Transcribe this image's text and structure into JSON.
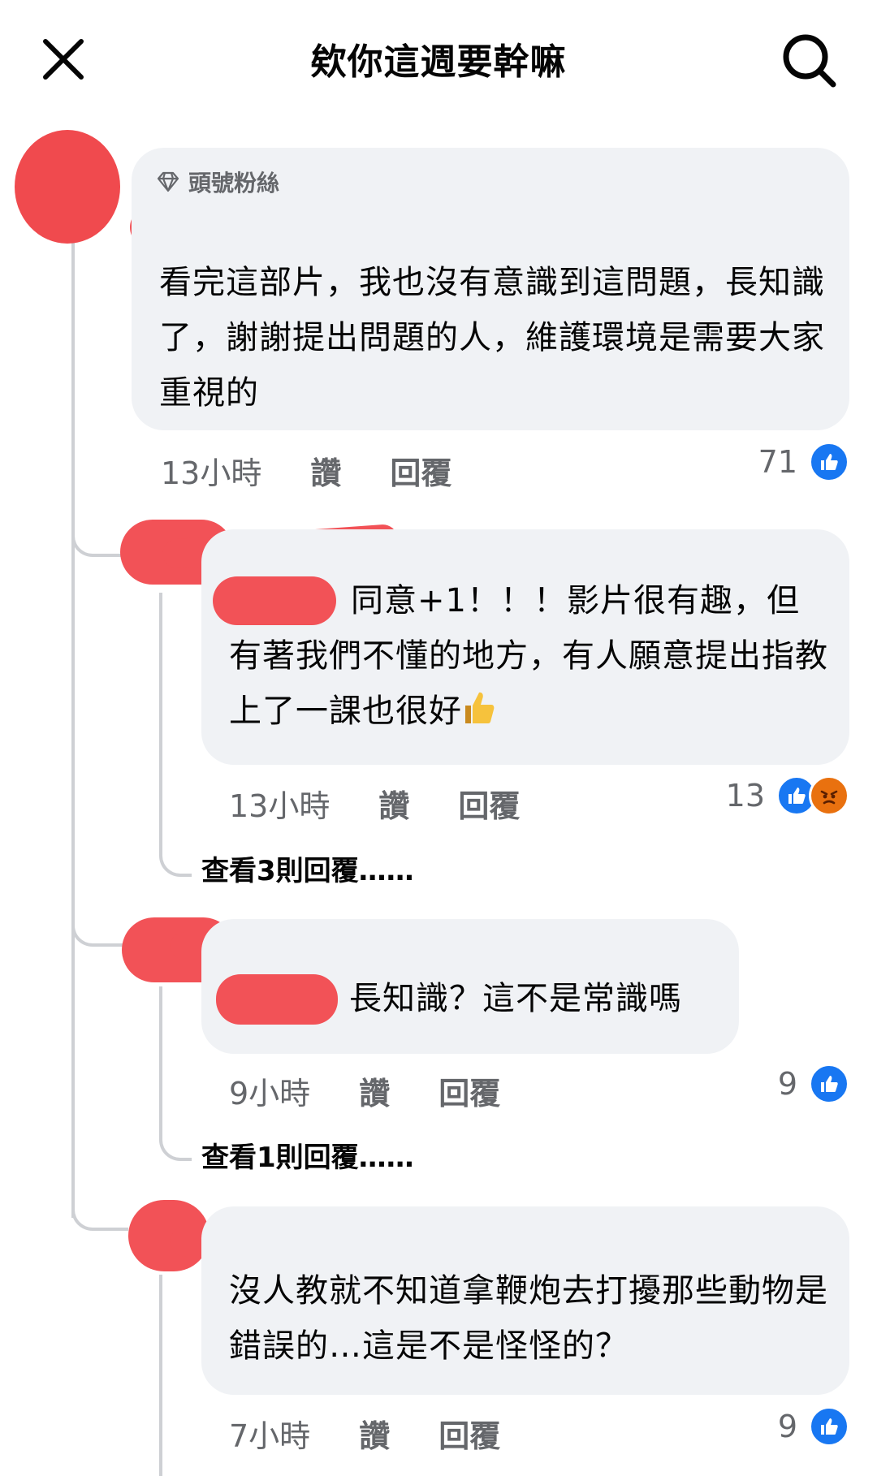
{
  "header": {
    "title": "欸你這週要幹嘛"
  },
  "comments": [
    {
      "badge": "頭號粉絲",
      "text": "看完這部片，我也沒有意識到這問題，長知識了，謝謝提出問題的人，維護環境是需要大家重視的",
      "time": "13小時",
      "like": "讚",
      "reply": "回覆",
      "reactions": "71"
    },
    {
      "text": "同意+1！！！影片很有趣，但有著我們不懂的地方，有人願意提出指教上了一課也很好",
      "time": "13小時",
      "like": "讚",
      "reply": "回覆",
      "reactions": "13",
      "view_replies": "查看3則回覆……"
    },
    {
      "text": "長知識？這不是常識嗎",
      "time": "9小時",
      "like": "讚",
      "reply": "回覆",
      "reactions": "9",
      "view_replies": "查看1則回覆……"
    },
    {
      "text": "沒人教就不知道拿鞭炮去打擾那些動物是錯誤的…這是不是怪怪的？",
      "time": "7小時",
      "like": "讚",
      "reply": "回覆",
      "reactions": "9"
    }
  ],
  "colors": {
    "accent": "#1877f2",
    "bubble": "#f0f2f5",
    "muted": "#65676b",
    "redaction": "#f25257"
  },
  "icons": [
    "close-icon",
    "search-icon",
    "diamond-icon",
    "like-icon",
    "angry-icon",
    "thumbs-up-emoji"
  ]
}
